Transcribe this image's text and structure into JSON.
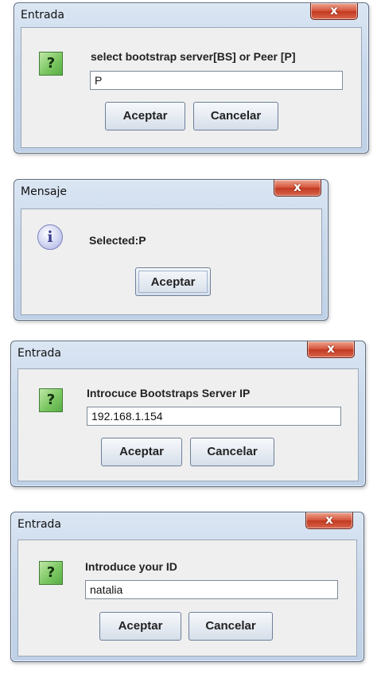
{
  "dialogs": [
    {
      "title": "Entrada",
      "close_label": "x",
      "icon": "question-icon",
      "prompt": "select bootstrap server[BS] or Peer [P]",
      "input_value": "P",
      "ok_label": "Aceptar",
      "cancel_label": "Cancelar"
    },
    {
      "title": "Mensaje",
      "close_label": "x",
      "icon": "info-icon",
      "message": "Selected:P",
      "ok_label": "Aceptar"
    },
    {
      "title": "Entrada",
      "close_label": "x",
      "icon": "question-icon",
      "prompt": "Introcuce Bootstraps Server IP",
      "input_value": "192.168.1.154",
      "ok_label": "Aceptar",
      "cancel_label": "Cancelar"
    },
    {
      "title": "Entrada",
      "close_label": "x",
      "icon": "question-icon",
      "prompt": "Introduce your ID",
      "input_value": "natalia",
      "ok_label": "Aceptar",
      "cancel_label": "Cancelar"
    }
  ],
  "icons": {
    "question": "?",
    "info": "i"
  }
}
